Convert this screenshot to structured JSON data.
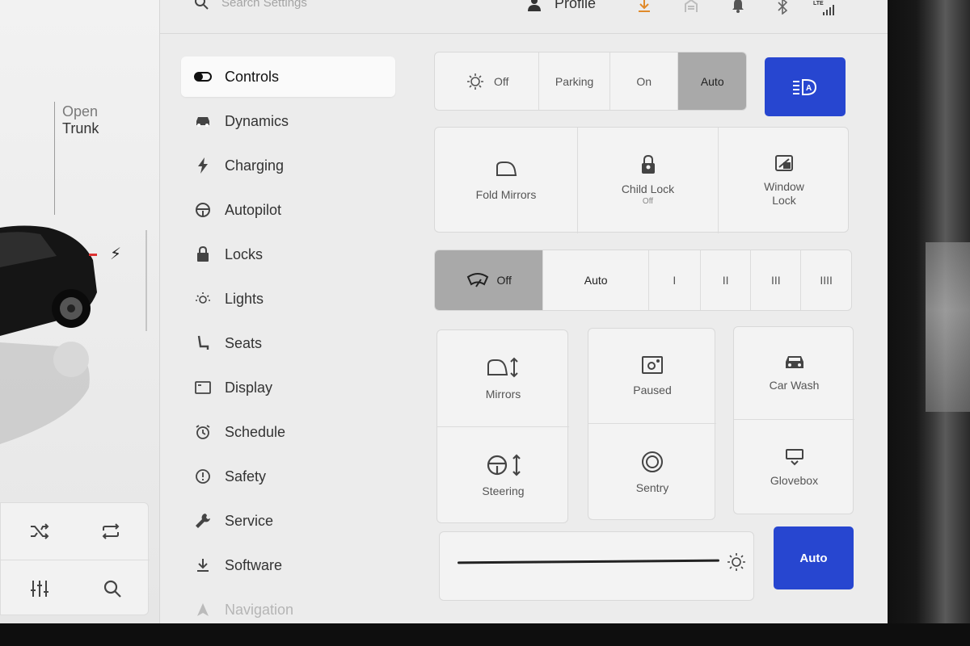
{
  "colors": {
    "accent": "#2746d0",
    "selected": "#a9a9a9",
    "download": "#e08a2a"
  },
  "topbar": {
    "search_placeholder": "Search Settings",
    "profile_label": "Profile",
    "icons": [
      "download-icon",
      "garage-icon",
      "bell-icon",
      "bluetooth-icon",
      "lte-signal-icon"
    ],
    "lte_label": "LTE"
  },
  "left_pane": {
    "trunk_open": "Open",
    "trunk_label": "Trunk",
    "media_icons": [
      "shuffle-icon",
      "repeat-icon",
      "equalizer-icon",
      "search-icon"
    ]
  },
  "nav": {
    "items": [
      {
        "label": "Controls",
        "icon": "toggle-icon",
        "active": true
      },
      {
        "label": "Dynamics",
        "icon": "car-icon"
      },
      {
        "label": "Charging",
        "icon": "bolt-icon"
      },
      {
        "label": "Autopilot",
        "icon": "steering-wheel-icon"
      },
      {
        "label": "Locks",
        "icon": "lock-icon"
      },
      {
        "label": "Lights",
        "icon": "light-icon"
      },
      {
        "label": "Seats",
        "icon": "seat-icon"
      },
      {
        "label": "Display",
        "icon": "display-icon"
      },
      {
        "label": "Schedule",
        "icon": "alarm-clock-icon"
      },
      {
        "label": "Safety",
        "icon": "alert-icon"
      },
      {
        "label": "Service",
        "icon": "wrench-icon"
      },
      {
        "label": "Software",
        "icon": "download-icon"
      },
      {
        "label": "Navigation",
        "icon": "navigation-icon"
      }
    ]
  },
  "lights": {
    "options": [
      "Off",
      "Parking",
      "On",
      "Auto"
    ],
    "selected": "Auto",
    "auto_high_beam_icon": "auto-high-beam-icon"
  },
  "locks_row": {
    "fold_mirrors": "Fold Mirrors",
    "child_lock": "Child Lock",
    "child_lock_state": "Off",
    "window_lock_line1": "Window",
    "window_lock_line2": "Lock"
  },
  "wipers": {
    "options": [
      "Off",
      "Auto",
      "I",
      "II",
      "III",
      "IIII"
    ],
    "selected": "Off"
  },
  "grid": {
    "mirrors": "Mirrors",
    "steering": "Steering",
    "dashcam": "Paused",
    "sentry": "Sentry",
    "car_wash": "Car Wash",
    "glovebox": "Glovebox"
  },
  "brightness": {
    "button_label": "Auto",
    "level": 1.0
  }
}
